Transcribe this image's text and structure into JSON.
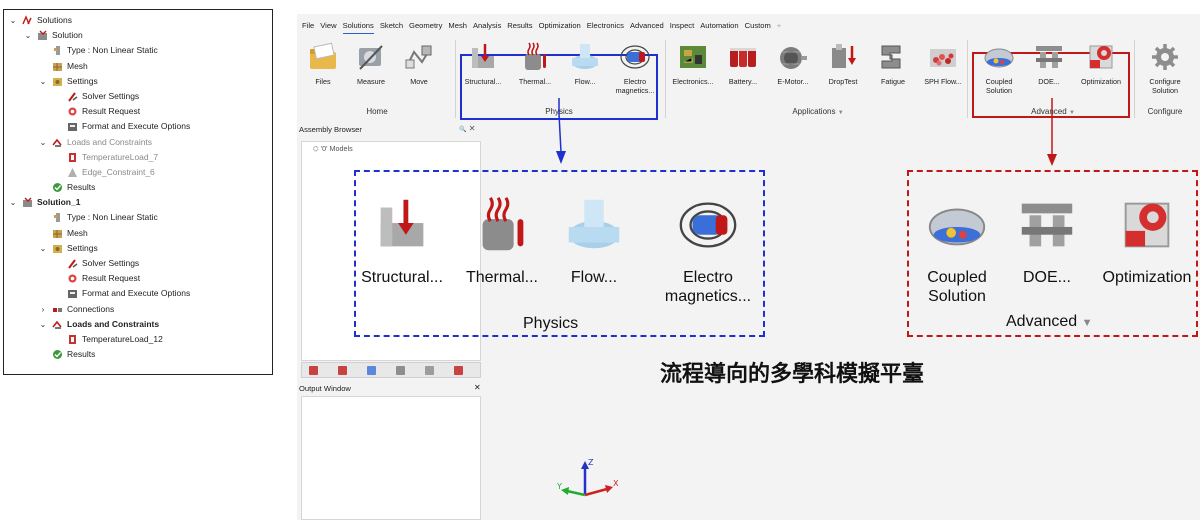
{
  "tree": [
    {
      "depth": 0,
      "chev": "open",
      "icon": "solutions",
      "label": "Solutions",
      "style": ""
    },
    {
      "depth": 1,
      "chev": "open",
      "icon": "solution",
      "label": "Solution",
      "style": ""
    },
    {
      "depth": 2,
      "chev": "",
      "icon": "type",
      "label": "Type : Non Linear Static",
      "style": ""
    },
    {
      "depth": 2,
      "chev": "",
      "icon": "mesh",
      "label": "Mesh",
      "style": ""
    },
    {
      "depth": 2,
      "chev": "open",
      "icon": "settings",
      "label": "Settings",
      "style": ""
    },
    {
      "depth": 3,
      "chev": "",
      "icon": "solver",
      "label": "Solver Settings",
      "style": ""
    },
    {
      "depth": 3,
      "chev": "",
      "icon": "result",
      "label": "Result Request",
      "style": ""
    },
    {
      "depth": 3,
      "chev": "",
      "icon": "format",
      "label": "Format and Execute Options",
      "style": ""
    },
    {
      "depth": 2,
      "chev": "open",
      "icon": "loads",
      "label": "Loads and Constraints",
      "style": "dim"
    },
    {
      "depth": 3,
      "chev": "",
      "icon": "tempload",
      "label": "TemperatureLoad_7",
      "style": "dim"
    },
    {
      "depth": 3,
      "chev": "",
      "icon": "edge",
      "label": "Edge_Constraint_6",
      "style": "dim"
    },
    {
      "depth": 2,
      "chev": "",
      "icon": "results",
      "label": "Results",
      "style": ""
    },
    {
      "depth": 0,
      "chev": "open",
      "icon": "solution",
      "label": "Solution_1",
      "style": "bold"
    },
    {
      "depth": 2,
      "chev": "",
      "icon": "type",
      "label": "Type : Non Linear Static",
      "style": ""
    },
    {
      "depth": 2,
      "chev": "",
      "icon": "mesh",
      "label": "Mesh",
      "style": ""
    },
    {
      "depth": 2,
      "chev": "open",
      "icon": "settings",
      "label": "Settings",
      "style": ""
    },
    {
      "depth": 3,
      "chev": "",
      "icon": "solver",
      "label": "Solver Settings",
      "style": ""
    },
    {
      "depth": 3,
      "chev": "",
      "icon": "result",
      "label": "Result Request",
      "style": ""
    },
    {
      "depth": 3,
      "chev": "",
      "icon": "format",
      "label": "Format and Execute Options",
      "style": ""
    },
    {
      "depth": 2,
      "chev": "closed",
      "icon": "connections",
      "label": "Connections",
      "style": ""
    },
    {
      "depth": 2,
      "chev": "open",
      "icon": "loads",
      "label": "Loads and Constraints",
      "style": "bold"
    },
    {
      "depth": 3,
      "chev": "",
      "icon": "tempload",
      "label": "TemperatureLoad_12",
      "style": ""
    },
    {
      "depth": 2,
      "chev": "",
      "icon": "results",
      "label": "Results",
      "style": ""
    }
  ],
  "menu": {
    "items": [
      "File",
      "View",
      "Solutions",
      "Sketch",
      "Geometry",
      "Mesh",
      "Analysis",
      "Results",
      "Optimization",
      "Electronics",
      "Advanced",
      "Inspect",
      "Automation",
      "Custom"
    ],
    "active": "Solutions",
    "add_symbol": "+"
  },
  "ribbon": {
    "buttons": [
      {
        "id": "files",
        "label": "Files",
        "icon": "folder-icon"
      },
      {
        "id": "measure",
        "label": "Measure",
        "icon": "measure-icon"
      },
      {
        "id": "move",
        "label": "Move",
        "icon": "move-icon"
      },
      {
        "id": "structural",
        "label": "Structural...",
        "icon": "structural-icon"
      },
      {
        "id": "thermal",
        "label": "Thermal...",
        "icon": "thermal-icon"
      },
      {
        "id": "flow",
        "label": "Flow...",
        "icon": "flow-icon"
      },
      {
        "id": "electro",
        "label": "Electro\nmagnetics...",
        "icon": "electromagnetics-icon"
      },
      {
        "id": "electronics",
        "label": "Electronics...",
        "icon": "pcb-icon"
      },
      {
        "id": "battery",
        "label": "Battery...",
        "icon": "battery-icon"
      },
      {
        "id": "emotor",
        "label": "E-Motor...",
        "icon": "motor-icon"
      },
      {
        "id": "droptest",
        "label": "DropTest",
        "icon": "droptest-icon"
      },
      {
        "id": "fatigue",
        "label": "Fatigue",
        "icon": "fatigue-icon"
      },
      {
        "id": "sph",
        "label": "SPH Flow...",
        "icon": "sph-icon"
      },
      {
        "id": "coupled",
        "label": "Coupled\nSolution",
        "icon": "coupled-icon"
      },
      {
        "id": "doe",
        "label": "DOE...",
        "icon": "doe-icon"
      },
      {
        "id": "optimization",
        "label": "Optimization",
        "icon": "optimization-icon"
      },
      {
        "id": "configure",
        "label": "Configure\nSolution",
        "icon": "gear-icon"
      }
    ],
    "groups": {
      "home": "Home",
      "physics": "Physics",
      "applications": "Applications",
      "advanced": "Advanced",
      "configure": "Configure"
    },
    "dropdown_symbol": "▼"
  },
  "assembly": {
    "title": "Assembly Browser",
    "search_symbol": "🔍",
    "close_symbol": "✕",
    "models_label": "'0' Models"
  },
  "output": {
    "title": "Output Window",
    "close_symbol": "✕"
  },
  "zoom_physics": {
    "items": [
      "Structural...",
      "Thermal...",
      "Flow...",
      "Electro\nmagnetics..."
    ],
    "group": "Physics"
  },
  "zoom_advanced": {
    "items": [
      "Coupled\nSolution",
      "DOE...",
      "Optimization"
    ],
    "group": "Advanced"
  },
  "caption": "流程導向的多學科模擬平臺",
  "axes": {
    "x": "X",
    "y": "Y",
    "z": "Z"
  },
  "colors": {
    "physics_highlight": "#2030d0",
    "advanced_highlight": "#c01818",
    "active_menu": "#2a62c9"
  }
}
